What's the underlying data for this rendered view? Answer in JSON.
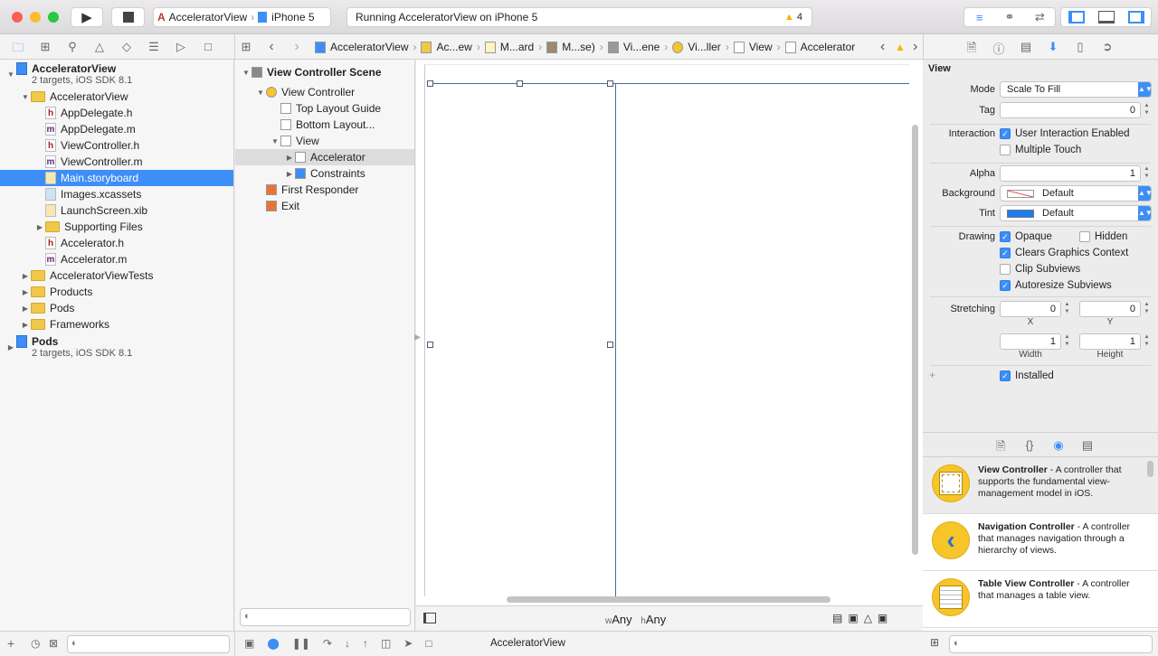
{
  "toolbar": {
    "scheme": "AcceleratorView",
    "device": "iPhone 5",
    "status": "Running AcceleratorView on iPhone 5",
    "warning_count": "4"
  },
  "breadcrumb": [
    "AcceleratorView",
    "Ac...ew",
    "M...ard",
    "M...se)",
    "Vi...ene",
    "Vi...ller",
    "View",
    "Accelerator"
  ],
  "navigator": {
    "items": [
      {
        "label": "AcceleratorView",
        "sub": "2 targets, iOS SDK 8.1",
        "kind": "project",
        "level": 0,
        "open": true
      },
      {
        "label": "AcceleratorView",
        "kind": "folder",
        "level": 1,
        "open": true
      },
      {
        "label": "AppDelegate.h",
        "kind": "h",
        "level": 2
      },
      {
        "label": "AppDelegate.m",
        "kind": "m",
        "level": 2
      },
      {
        "label": "ViewController.h",
        "kind": "h",
        "level": 2
      },
      {
        "label": "ViewController.m",
        "kind": "m",
        "level": 2
      },
      {
        "label": "Main.storyboard",
        "kind": "sb",
        "level": 2,
        "selected": true
      },
      {
        "label": "Images.xcassets",
        "kind": "xc",
        "level": 2
      },
      {
        "label": "LaunchScreen.xib",
        "kind": "xib",
        "level": 2
      },
      {
        "label": "Supporting Files",
        "kind": "folder",
        "level": 2,
        "open": false
      },
      {
        "label": "Accelerator.h",
        "kind": "h",
        "level": 2
      },
      {
        "label": "Accelerator.m",
        "kind": "m",
        "level": 2
      },
      {
        "label": "AcceleratorViewTests",
        "kind": "folder",
        "level": 1,
        "open": false
      },
      {
        "label": "Products",
        "kind": "folder",
        "level": 1,
        "open": false
      },
      {
        "label": "Pods",
        "kind": "folder",
        "level": 1,
        "open": false
      },
      {
        "label": "Frameworks",
        "kind": "folder",
        "level": 1,
        "open": false
      },
      {
        "label": "Pods",
        "sub": "2 targets, iOS SDK 8.1",
        "kind": "project",
        "level": 0,
        "open": false
      }
    ]
  },
  "outline": {
    "items": [
      {
        "label": "View Controller Scene",
        "kind": "scene",
        "level": 0,
        "open": true,
        "bold": true
      },
      {
        "label": "View Controller",
        "kind": "vc",
        "level": 1,
        "open": true
      },
      {
        "label": "Top Layout Guide",
        "kind": "view",
        "level": 2
      },
      {
        "label": "Bottom Layout...",
        "kind": "view",
        "level": 2
      },
      {
        "label": "View",
        "kind": "view",
        "level": 2,
        "open": true
      },
      {
        "label": "Accelerator",
        "kind": "view",
        "level": 3,
        "open": false,
        "selected": true
      },
      {
        "label": "Constraints",
        "kind": "cons",
        "level": 3,
        "open": false
      },
      {
        "label": "First Responder",
        "kind": "fr",
        "level": 1
      },
      {
        "label": "Exit",
        "kind": "exit",
        "level": 1
      }
    ]
  },
  "canvas": {
    "w_label": "w",
    "w_value": "Any",
    "h_label": "h",
    "h_value": "Any"
  },
  "debug": {
    "target": "AcceleratorView"
  },
  "inspector": {
    "section": "View",
    "mode_label": "Mode",
    "mode_value": "Scale To Fill",
    "tag_label": "Tag",
    "tag_value": "0",
    "interaction_label": "Interaction",
    "user_interaction": "User Interaction Enabled",
    "multiple_touch": "Multiple Touch",
    "alpha_label": "Alpha",
    "alpha_value": "1",
    "background_label": "Background",
    "background_value": "Default",
    "tint_label": "Tint",
    "tint_value": "Default",
    "tint_color": "#1a7ef0",
    "drawing_label": "Drawing",
    "opaque": "Opaque",
    "hidden": "Hidden",
    "clears": "Clears Graphics Context",
    "clip": "Clip Subviews",
    "autoresize": "Autoresize Subviews",
    "stretching_label": "Stretching",
    "x_value": "0",
    "y_value": "0",
    "x_label": "X",
    "y_label": "Y",
    "width_value": "1",
    "height_value": "1",
    "width_label": "Width",
    "height_label": "Height",
    "installed": "Installed",
    "plus": "+",
    "checks": {
      "user_interaction": true,
      "multiple_touch": false,
      "opaque": true,
      "hidden": false,
      "clears": true,
      "clip": false,
      "autoresize": true,
      "installed": true
    }
  },
  "library": {
    "items": [
      {
        "title": "View Controller",
        "desc": " - A controller that supports the fundamental view-management model in iOS."
      },
      {
        "title": "Navigation Controller",
        "desc": " - A controller that manages navigation through a hierarchy of views."
      },
      {
        "title": "Table View Controller",
        "desc": " - A controller that manages a table view."
      }
    ]
  },
  "colors": {
    "accent": "#3d8ef7",
    "selection": "#3d8ef7",
    "warning": "#f5b800"
  }
}
